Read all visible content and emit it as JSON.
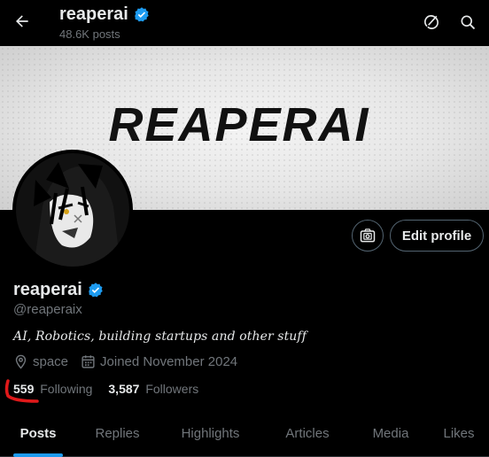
{
  "header": {
    "name": "reaperai",
    "posts_count": "48.6K posts"
  },
  "banner": {
    "logo_text": "REAPERAI"
  },
  "profile": {
    "name": "reaperai",
    "handle": "@reaperaix",
    "bio": "AI, Robotics, building startups and other stuff",
    "location": "space",
    "joined": "Joined November 2024",
    "verified": true,
    "edit_button": "Edit profile"
  },
  "stats": {
    "following_count": "559",
    "following_label": "Following",
    "followers_count": "3,587",
    "followers_label": "Followers"
  },
  "tabs": [
    {
      "label": "Posts",
      "active": true
    },
    {
      "label": "Replies",
      "active": false
    },
    {
      "label": "Highlights",
      "active": false
    },
    {
      "label": "Articles",
      "active": false
    },
    {
      "label": "Media",
      "active": false
    },
    {
      "label": "Likes",
      "active": false
    }
  ],
  "icons": {
    "back": "arrow-left-icon",
    "grok": "grok-icon",
    "search": "search-icon",
    "verified": "verified-badge-icon",
    "camera": "camera-icon",
    "location": "location-icon",
    "calendar": "calendar-icon"
  },
  "colors": {
    "accent": "#1d9bf0",
    "annotation": "#e0191a"
  }
}
